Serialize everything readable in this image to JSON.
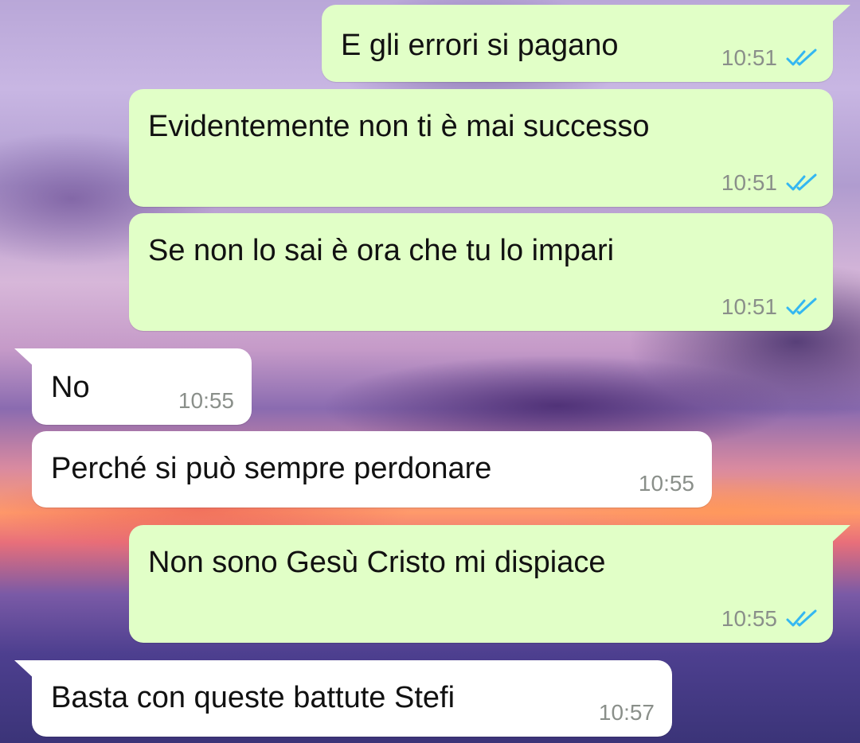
{
  "colors": {
    "outgoing_bubble": "#e1ffc7",
    "incoming_bubble": "#ffffff",
    "read_ticks": "#34b7f1",
    "timestamp": "#8a8f8a"
  },
  "messages": [
    {
      "direction": "outgoing",
      "text": "E gli errori si pagano",
      "time": "10:51",
      "status_icon": "double-check-read-icon"
    },
    {
      "direction": "outgoing",
      "text": "Evidentemente non ti è mai successo",
      "time": "10:51",
      "status_icon": "double-check-read-icon"
    },
    {
      "direction": "outgoing",
      "text": "Se non lo sai è ora che tu lo impari",
      "time": "10:51",
      "status_icon": "double-check-read-icon"
    },
    {
      "direction": "incoming",
      "text": "No",
      "time": "10:55"
    },
    {
      "direction": "incoming",
      "text": "Perché si può sempre perdonare",
      "time": "10:55"
    },
    {
      "direction": "outgoing",
      "text": "Non sono Gesù Cristo mi dispiace",
      "time": "10:55",
      "status_icon": "double-check-read-icon"
    },
    {
      "direction": "incoming",
      "text": "Basta con queste battute Stefi",
      "time": "10:57"
    }
  ]
}
